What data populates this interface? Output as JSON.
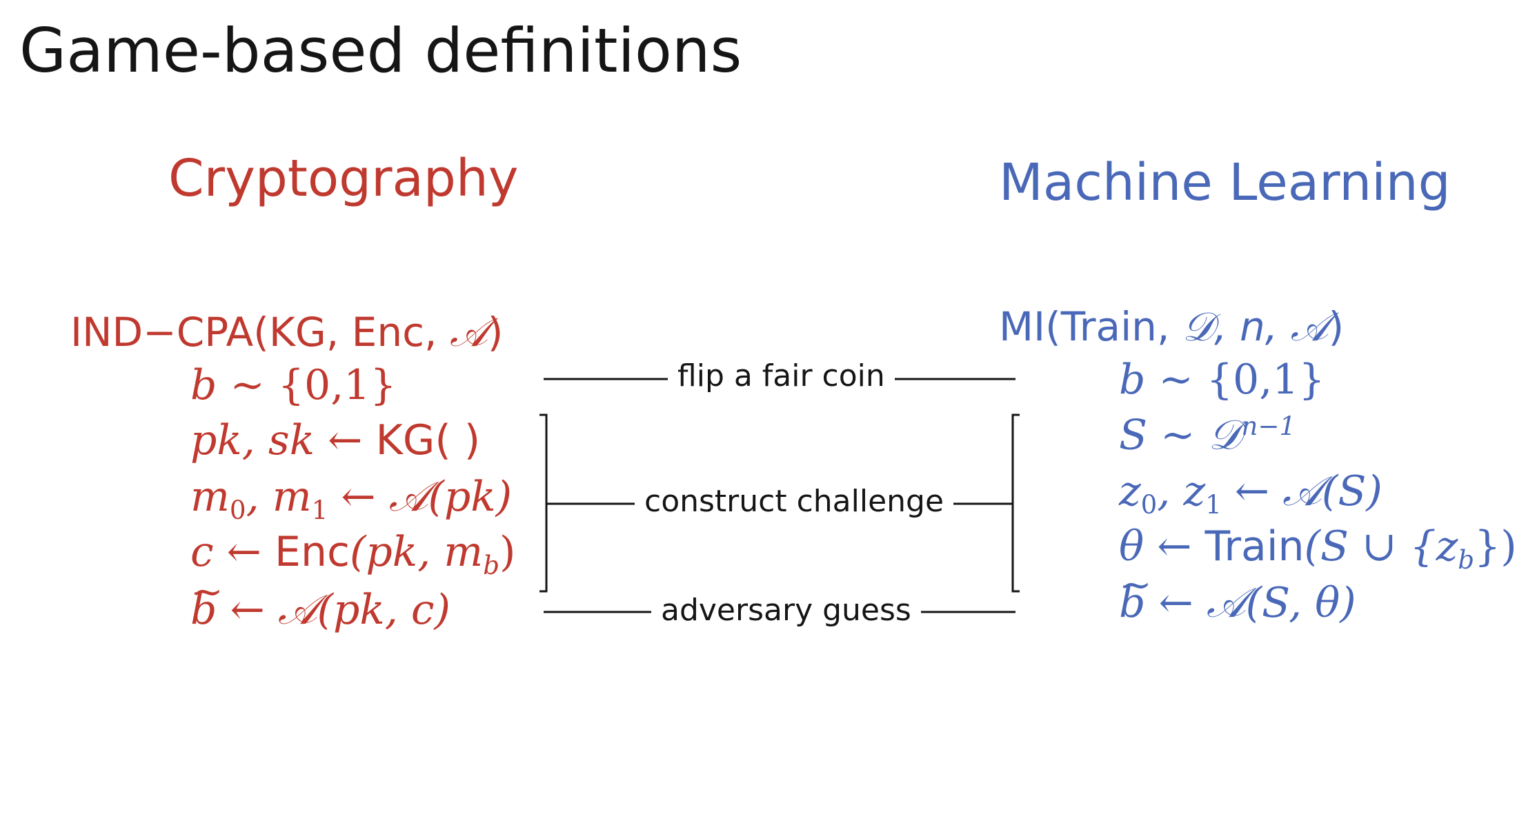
{
  "title": "Game-based definitions",
  "crypto": {
    "heading": "Cryptography",
    "header": [
      "IND−CPA(KG, Enc, ",
      "𝒜",
      ")"
    ],
    "lines": {
      "b": [
        "b",
        " ∼ {0,1}"
      ],
      "keygen": [
        "pk, sk",
        " ← ",
        "KG( )"
      ],
      "messages": [
        "m",
        "0",
        ", m",
        "1",
        " ← ",
        "𝒜",
        "(pk)"
      ],
      "encrypt": [
        "c",
        " ← ",
        "Enc",
        "(pk, m",
        "b",
        ")"
      ],
      "guess": [
        "b",
        " ← ",
        "𝒜",
        "(pk, c)"
      ]
    }
  },
  "ml": {
    "heading": "Machine Learning",
    "header": [
      "MI(Train, ",
      "𝒟",
      ", n, ",
      "𝒜",
      ")"
    ],
    "lines": {
      "b": [
        "b",
        " ∼ {0,1}"
      ],
      "sample": [
        "S",
        " ∼ ",
        "𝒟",
        "n−1"
      ],
      "points": [
        "z",
        "0",
        ", z",
        "1",
        " ← ",
        "𝒜",
        "(S)"
      ],
      "train": [
        "θ",
        " ← ",
        "Train",
        "(S ∪ {z",
        "b",
        "})"
      ],
      "guess": [
        "b",
        " ← ",
        "𝒜",
        "(S, θ)"
      ]
    }
  },
  "connectors": {
    "coin": "flip a fair coin",
    "challenge": "construct challenge",
    "guess": "adversary guess"
  },
  "colors": {
    "crypto": "#c0392f",
    "ml": "#4a68b8",
    "text": "#151515"
  }
}
